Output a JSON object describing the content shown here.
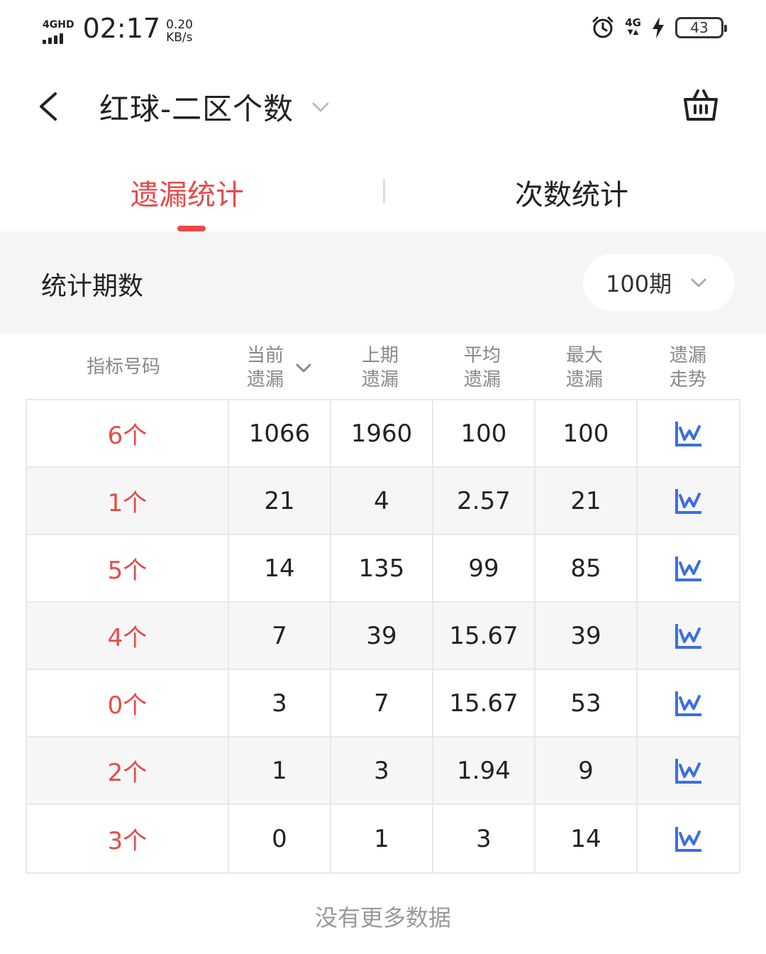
{
  "status_bar": {
    "network_label": "4GHD",
    "time": "02:17",
    "speed_value": "0.20",
    "speed_unit": "KB/s",
    "net_right_top": "4G",
    "net_right_bottom": "▼▲",
    "battery": "43"
  },
  "header": {
    "title": "红球-二区个数"
  },
  "tabs": [
    {
      "label": "遗漏统计",
      "active": true
    },
    {
      "label": "次数统计",
      "active": false
    }
  ],
  "period": {
    "label": "统计期数",
    "value": "100期"
  },
  "table": {
    "headers": [
      {
        "line1": "指标号码",
        "line2": ""
      },
      {
        "line1": "当前",
        "line2": "遗漏"
      },
      {
        "line1": "上期",
        "line2": "遗漏"
      },
      {
        "line1": "平均",
        "line2": "遗漏"
      },
      {
        "line1": "最大",
        "line2": "遗漏"
      },
      {
        "line1": "遗漏",
        "line2": "走势"
      }
    ],
    "rows": [
      {
        "indicator": "6个",
        "current": "1066",
        "last": "1960",
        "avg": "100",
        "max": "100"
      },
      {
        "indicator": "1个",
        "current": "21",
        "last": "4",
        "avg": "2.57",
        "max": "21"
      },
      {
        "indicator": "5个",
        "current": "14",
        "last": "135",
        "avg": "99",
        "max": "85"
      },
      {
        "indicator": "4个",
        "current": "7",
        "last": "39",
        "avg": "15.67",
        "max": "39"
      },
      {
        "indicator": "0个",
        "current": "3",
        "last": "7",
        "avg": "15.67",
        "max": "53"
      },
      {
        "indicator": "2个",
        "current": "1",
        "last": "3",
        "avg": "1.94",
        "max": "9"
      },
      {
        "indicator": "3个",
        "current": "0",
        "last": "1",
        "avg": "3",
        "max": "14"
      }
    ]
  },
  "footer": {
    "no_more": "没有更多数据"
  },
  "colors": {
    "accent": "#e84a4a",
    "trend_icon": "#3b6fe0"
  }
}
